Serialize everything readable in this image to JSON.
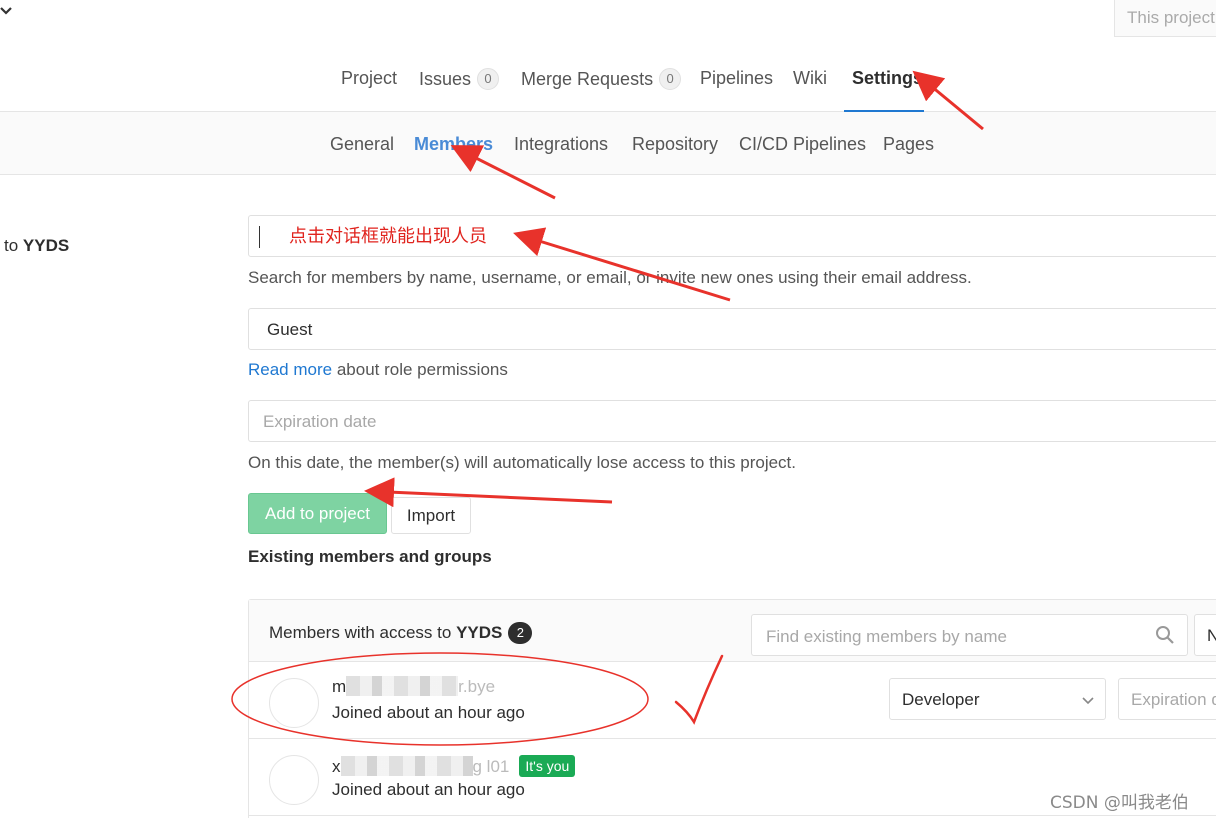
{
  "header": {
    "search_placeholder": "This project"
  },
  "nav": {
    "items": [
      {
        "label": "Project"
      },
      {
        "label": "Issues",
        "count": "0"
      },
      {
        "label": "Merge Requests",
        "count": "0"
      },
      {
        "label": "Pipelines"
      },
      {
        "label": "Wiki"
      },
      {
        "label": "Settings",
        "active": true
      }
    ]
  },
  "subnav": {
    "items": [
      {
        "label": "General"
      },
      {
        "label": "Members",
        "active": true
      },
      {
        "label": "Integrations"
      },
      {
        "label": "Repository"
      },
      {
        "label": "CI/CD Pipelines"
      },
      {
        "label": "Pages"
      }
    ]
  },
  "form": {
    "left_label_prefix": "to",
    "project_name": "YYDS",
    "member_search_annotation": "点击对话框就能出现人员",
    "member_search_help": "Search for members by name, username, or email, or invite new ones using their email address.",
    "role_value": "Guest",
    "role_link": "Read more",
    "role_help_suffix": " about role permissions",
    "expiration_placeholder": "Expiration date",
    "expiration_help": "On this date, the member(s) will automatically lose access to this project.",
    "add_button": "Add to project",
    "import_button": "Import"
  },
  "members": {
    "section_title": "Existing members and groups",
    "panel_title_prefix": "Members with access to",
    "project_name": "YYDS",
    "count": "2",
    "find_placeholder": "Find existing members by name",
    "sort_button": "N",
    "rows": [
      {
        "name_start": "m",
        "name_end": "r.bye",
        "joined": "Joined about an hour ago",
        "role": "Developer",
        "expiration_placeholder": "Expiration date"
      },
      {
        "name_start": "x",
        "name_end": "g    l01",
        "joined": "Joined about an hour ago",
        "you_badge": "It's you"
      }
    ]
  },
  "watermark": "CSDN @叫我老伯",
  "colors": {
    "accent": "#1f78d1",
    "add_button": "#7ed3a2",
    "you_badge": "#1aaa55",
    "annotation": "#e0231d"
  }
}
